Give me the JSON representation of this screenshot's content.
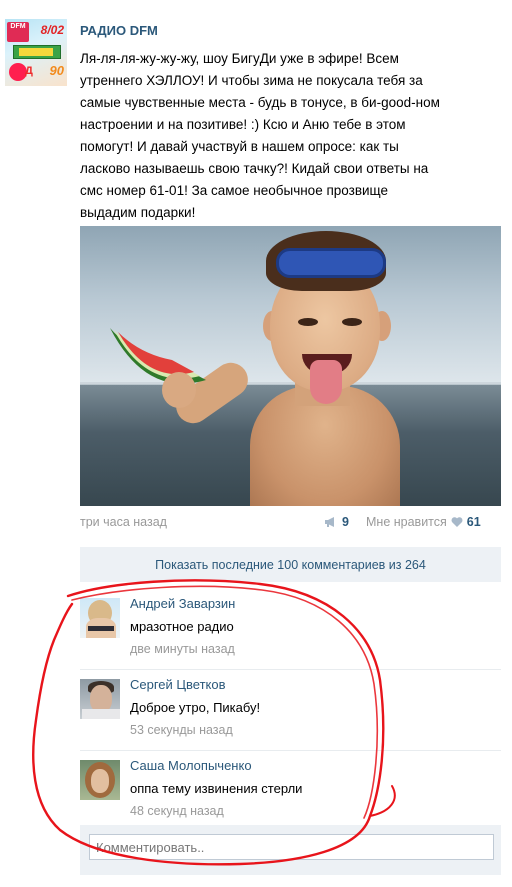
{
  "post": {
    "author": "РАДИО DFM",
    "avatar_text": {
      "date": "8/02",
      "ninety": "90",
      "disco": "Д"
    },
    "text": "Ля-ля-ля-жу-жу-жу, шоу БигуДи уже в эфире! Всем\nутреннего ХЭЛЛОУ! И чтобы зима не покусала тебя за\nсамые чувственные места - будь в тонусе, в би-good-ном\nнастроении и на позитиве! :) Ксю и Аню тебе в этом\nпомогут! И давай участвуй в нашем опросе: как ты\nласково называешь свою тачку?! Кидай свои ответы на\nсмс номер 61-01! За самое необычное прозвище\nвыдадим подарки!",
    "time": "три часа назад",
    "reposts": "9",
    "likes_label": "Мне нравится",
    "likes_count": "61"
  },
  "show_all_comments": "Показать последние 100 комментариев из 264",
  "comments": [
    {
      "name": "Андрей Заварзин",
      "text": "мразотное радио",
      "time": "две минуты назад"
    },
    {
      "name": "Сергей Цветков",
      "text": "Доброе утро, Пикабу!",
      "time": "53 секунды назад"
    },
    {
      "name": "Саша Молопыченко",
      "text": "оппа тему извинения стерли",
      "time": "48 секунд назад"
    }
  ],
  "comment_input": {
    "placeholder": "Комментировать.."
  },
  "colors": {
    "link": "#2b587a",
    "muted": "#999999",
    "panel": "#edf1f5",
    "annotation": "#e8141b"
  },
  "icons": [
    "megaphone-icon",
    "heart-icon"
  ]
}
